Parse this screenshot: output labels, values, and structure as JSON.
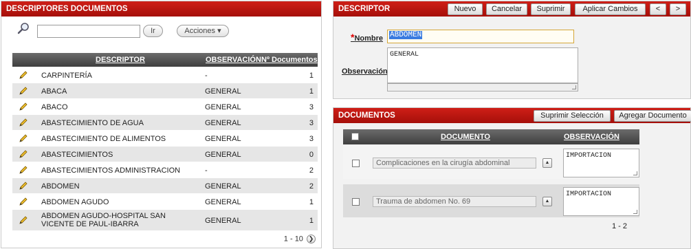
{
  "left_panel": {
    "title": "DESCRIPTORES DOCUMENTOS",
    "search": {
      "value": "",
      "go_label": "Ir"
    },
    "actions_label": "Acciones ▾",
    "columns": [
      "DESCRIPTOR",
      "OBSERVACIÓN",
      "Nº Documentos"
    ],
    "rows": [
      {
        "descriptor": "CARPINTERÍA",
        "observacion": "-",
        "documentos": "1"
      },
      {
        "descriptor": "ABACA",
        "observacion": "GENERAL",
        "documentos": "1"
      },
      {
        "descriptor": "ABACO",
        "observacion": "GENERAL",
        "documentos": "3"
      },
      {
        "descriptor": "ABASTECIMIENTO DE AGUA",
        "observacion": "GENERAL",
        "documentos": "3"
      },
      {
        "descriptor": "ABASTECIMIENTO DE ALIMENTOS",
        "observacion": "GENERAL",
        "documentos": "3"
      },
      {
        "descriptor": "ABASTECIMIENTOS",
        "observacion": "GENERAL",
        "documentos": "0"
      },
      {
        "descriptor": "ABASTECIMIENTOS ADMINISTRACION",
        "observacion": "-",
        "documentos": "2"
      },
      {
        "descriptor": "ABDOMEN",
        "observacion": "GENERAL",
        "documentos": "2"
      },
      {
        "descriptor": "ABDOMEN AGUDO",
        "observacion": "GENERAL",
        "documentos": "1"
      },
      {
        "descriptor": "ABDOMEN AGUDO-HOSPITAL SAN VICENTE DE PAUL-IBARRA",
        "observacion": "GENERAL",
        "documentos": "1"
      }
    ],
    "pagination": "1 - 10"
  },
  "descriptor_panel": {
    "title": "DESCRIPTOR",
    "buttons": {
      "nuevo": "Nuevo",
      "cancelar": "Cancelar",
      "suprimir": "Suprimir",
      "aplicar": "Aplicar Cambios",
      "prev": "<",
      "next": ">"
    },
    "nombre_label": "Nombre",
    "required_mark": "*",
    "nombre_value": "ABDOMEN",
    "observacion_label": "Observación",
    "observacion_value": "GENERAL"
  },
  "documents_panel": {
    "title": "DOCUMENTOS",
    "buttons": {
      "suprimir": "Suprimir Selección",
      "agregar": "Agregar Documento"
    },
    "columns": [
      "DOCUMENTO",
      "OBSERVACIÓN"
    ],
    "rows": [
      {
        "documento": "Complicaciones en la cirugía abdominal",
        "observacion": "IMPORTACION"
      },
      {
        "documento": "Trauma de abdomen No. 69",
        "observacion": "IMPORTACION"
      }
    ],
    "pagination": "1 - 2"
  },
  "colors": {
    "header_red": "#c4140f",
    "table_header": "#4f4f4f",
    "accent_selection": "#3a7be0"
  }
}
